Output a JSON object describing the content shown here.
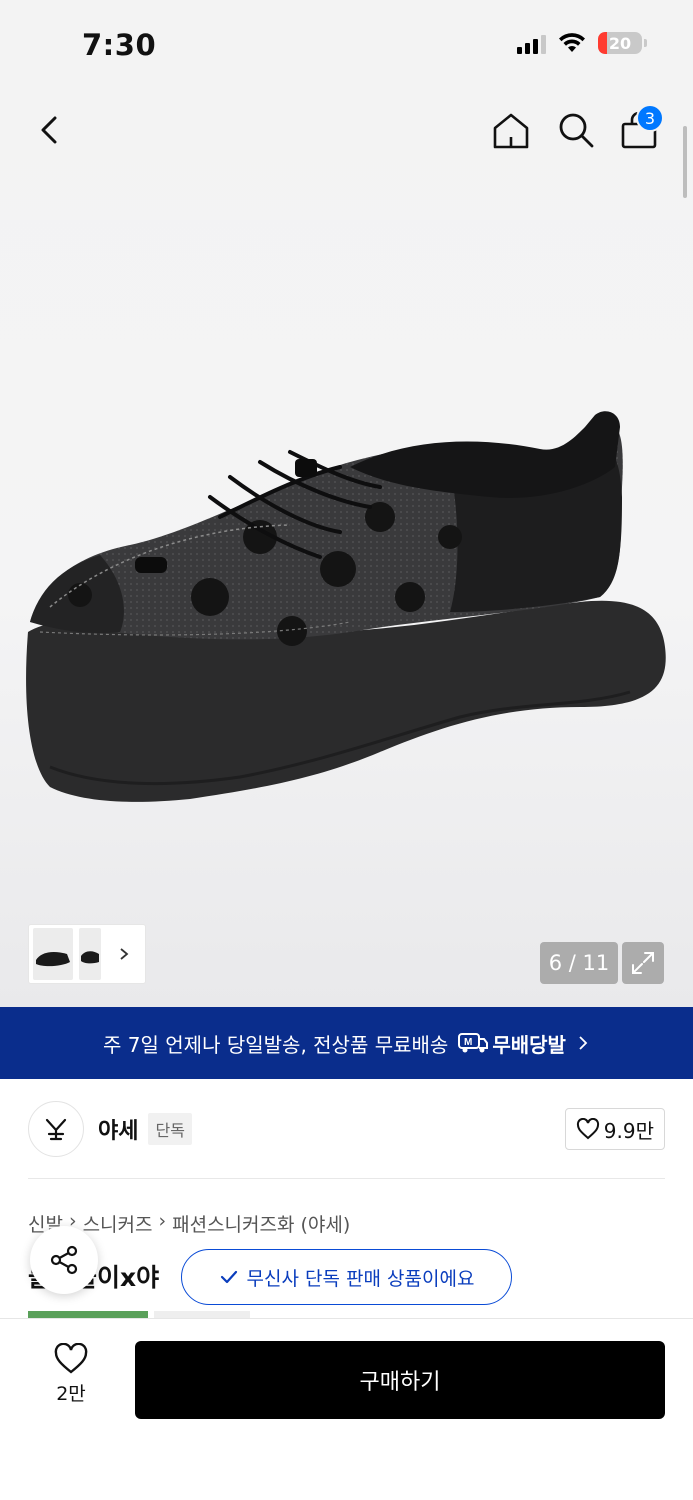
{
  "status_bar": {
    "time": "7:30",
    "battery": "20",
    "battery_level": 0.2,
    "battery_color": "#ff3b30"
  },
  "header": {
    "cart_count": "3",
    "accent": "#0078ff"
  },
  "gallery": {
    "counter": "6 / 11"
  },
  "delivery_banner": {
    "text": "주 7일 언제나 당일발송, 전상품 무료배송",
    "badge": "무배당발",
    "background": "#0a2d8c"
  },
  "brand": {
    "name": "야세",
    "tag": "단독",
    "likes": "9.9만"
  },
  "breadcrumb": [
    "신발",
    "스니커즈",
    "패션스니커즈화 (야세)"
  ],
  "product": {
    "title_partial": "물방울이x야"
  },
  "exclusive_notice": "무신사 단독 판매 상품이에요",
  "bottom_bar": {
    "wish_count": "2만",
    "buy_label": "구매하기"
  },
  "icons": [
    "back-icon",
    "home-icon",
    "search-icon",
    "cart-icon",
    "chevron-right-icon",
    "expand-icon",
    "heart-icon",
    "share-icon",
    "check-icon"
  ]
}
